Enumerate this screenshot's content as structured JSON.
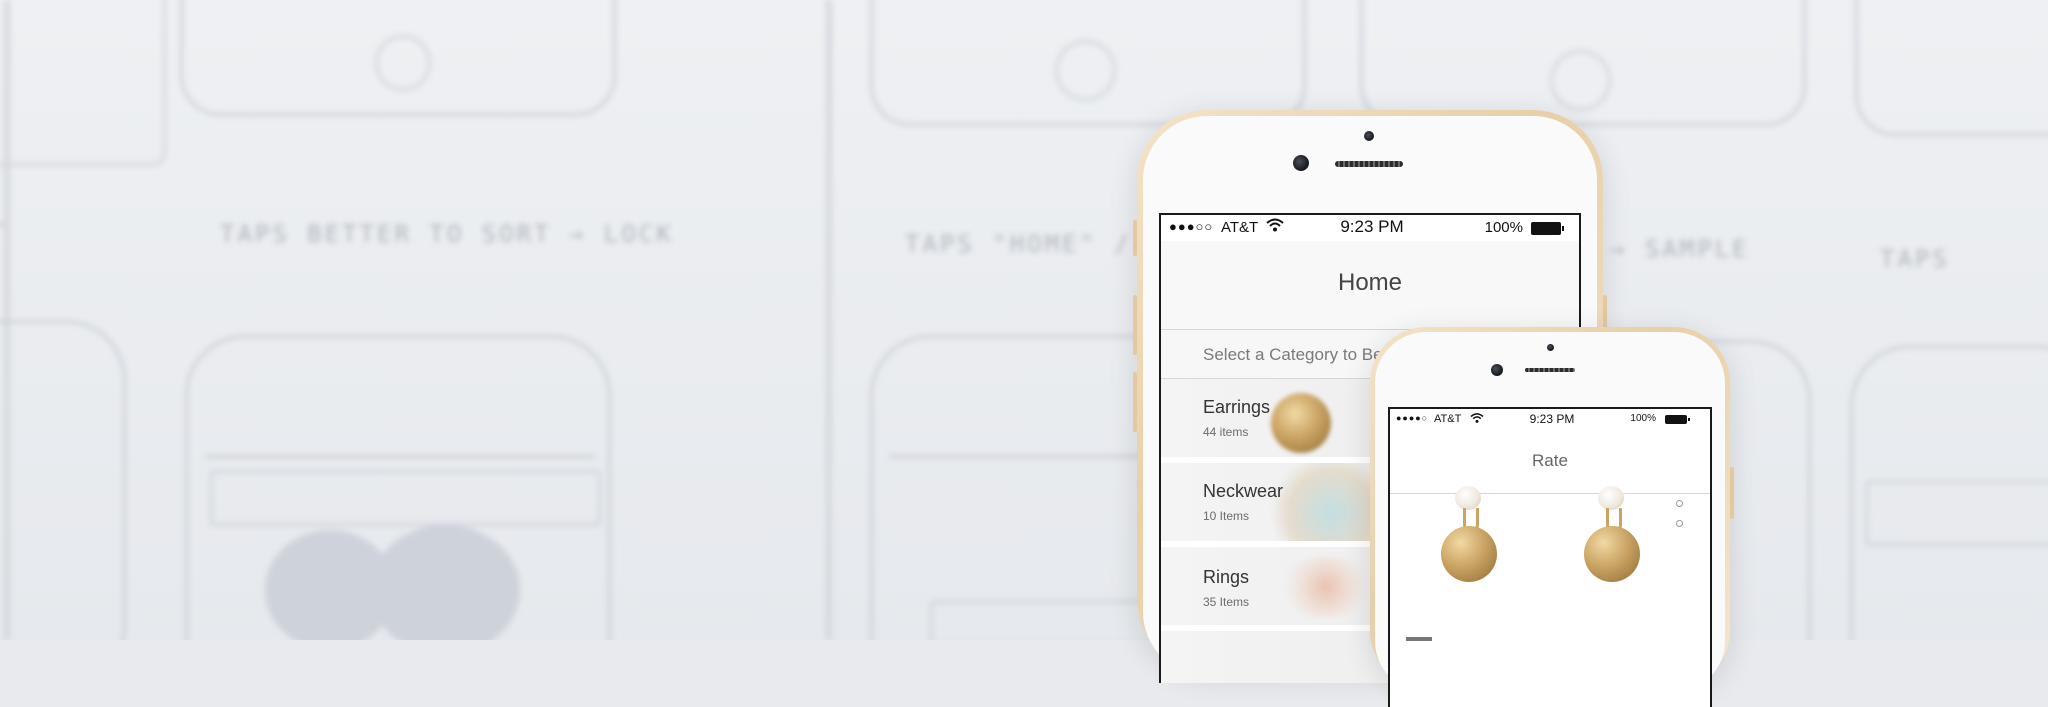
{
  "background": {
    "sketch_texts": [
      "TAPS BETTER TO SORT → LOCK",
      "TAPS \"HOME\" / ON",
      "→ SAMPLE",
      "TAPS"
    ]
  },
  "big_phone": {
    "status_bar": {
      "signal": "●●●○○",
      "carrier": "AT&T",
      "wifi_icon": "wifi-icon",
      "time": "9:23 PM",
      "battery_pct": "100%"
    },
    "nav_title": "Home",
    "subheading": "Select a Category to Begin",
    "categories": [
      {
        "name": "Earrings",
        "count": "44 items"
      },
      {
        "name": "Neckwear",
        "count": "10 Items"
      },
      {
        "name": "Rings",
        "count": "35 Items"
      }
    ]
  },
  "small_phone": {
    "status_bar": {
      "signal": "●●●●○",
      "carrier": "AT&T",
      "wifi_icon": "wifi-icon",
      "time": "9:23 PM",
      "battery_pct": "100%"
    },
    "nav_title": "Rate"
  },
  "colors": {
    "phone_gold": "#e8cfa8",
    "earring_gold": "#caa464",
    "backdrop": "#e8eaee"
  }
}
